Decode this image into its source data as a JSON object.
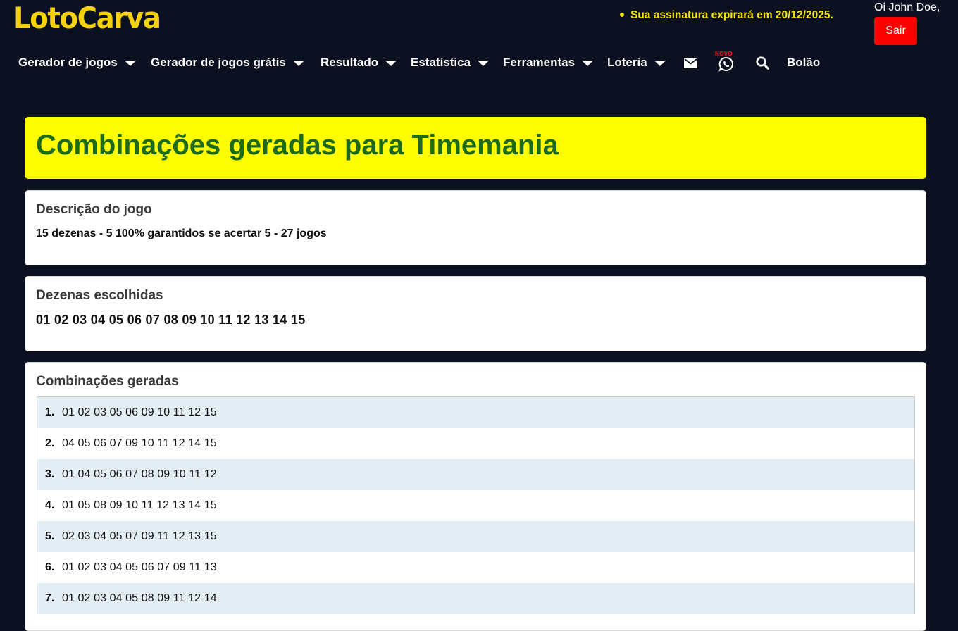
{
  "header": {
    "logo": "LotoCarva",
    "subscription_notice": "Sua assinatura expirará em 20/12/2025.",
    "greeting": "Oi John Doe,",
    "logout_label": "Sair"
  },
  "nav": {
    "items": [
      {
        "label": "Gerador de jogos",
        "has_caret": true
      },
      {
        "label": "Gerador de jogos grátis",
        "has_caret": true
      },
      {
        "label": "Resultado",
        "has_caret": true
      },
      {
        "label": "Estatística",
        "has_caret": true
      },
      {
        "label": "Ferramentas",
        "has_caret": true
      },
      {
        "label": "Loteria",
        "has_caret": true
      }
    ],
    "icons": [
      "envelope-icon",
      "whatsapp-icon",
      "search-icon"
    ],
    "whatsapp_badge": "NOVO",
    "bolao_label": "Bolão"
  },
  "main": {
    "title": "Combinações geradas para Timemania",
    "description": {
      "heading": "Descrição do jogo",
      "text": "15 dezenas - 5 100% garantidos se acertar 5 - 27 jogos"
    },
    "chosen": {
      "heading": "Dezenas escolhidas",
      "numbers": "01 02 03 04 05 06 07 08 09 10 11 12 13 14 15"
    },
    "combinations": {
      "heading": "Combinações geradas",
      "rows": [
        {
          "index": "1.",
          "values": "01 02 03 05 06 09 10 11 12 15"
        },
        {
          "index": "2.",
          "values": "04 05 06 07 09 10 11 12 14 15"
        },
        {
          "index": "3.",
          "values": "01 04 05 06 07 08 09 10 11 12"
        },
        {
          "index": "4.",
          "values": "01 05 08 09 10 11 12 13 14 15"
        },
        {
          "index": "5.",
          "values": "02 03 04 05 07 09 11 12 13 15"
        },
        {
          "index": "6.",
          "values": "01 02 03 04 05 06 07 09 11 13"
        },
        {
          "index": "7.",
          "values": "01 02 03 04 05 08 09 11 12 14"
        }
      ]
    }
  },
  "colors": {
    "background": "#0b1120",
    "logo": "#f5d20c",
    "title_bg": "#ffff00",
    "title_text": "#1d6b1a",
    "logout_bg": "#ff0000",
    "row_alt": "#e3eef4"
  }
}
